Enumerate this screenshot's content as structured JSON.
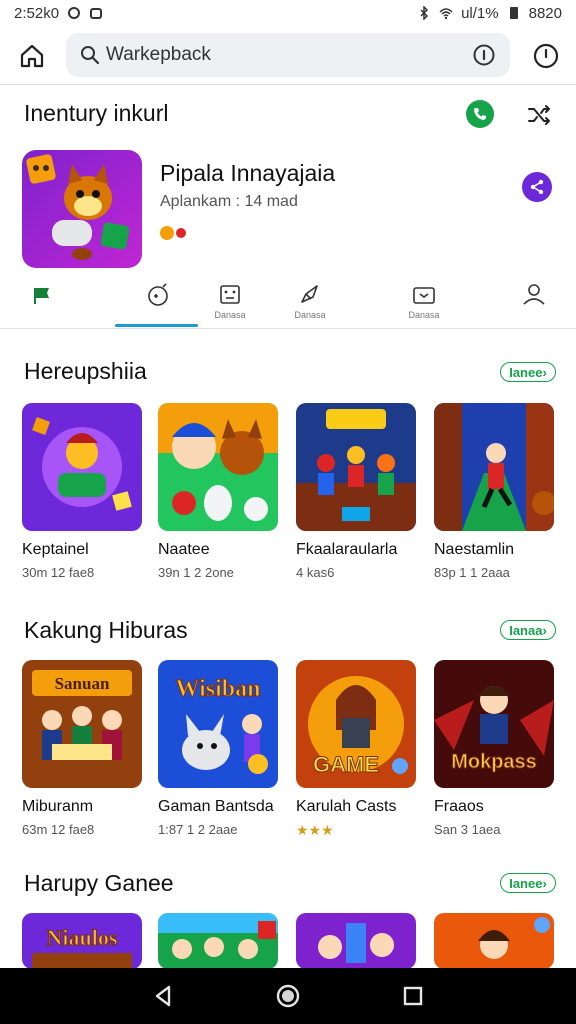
{
  "status_bar": {
    "time": "2:52k0",
    "right_text": "ul/1%",
    "battery": "8820"
  },
  "search": {
    "value": "Warkepback"
  },
  "header": {
    "title": "Inentury inkurl"
  },
  "featured_app": {
    "title": "Pipala Innayajaia",
    "subtitle": "Aplankam : 14 mad"
  },
  "tabs": [
    {
      "label": ""
    },
    {
      "label": ""
    },
    {
      "label": "Danasa"
    },
    {
      "label": "Danasa"
    },
    {
      "label": "Danasa"
    },
    {
      "label": ""
    }
  ],
  "sections": [
    {
      "title": "Hereupshiia",
      "more": "Ianee",
      "cards": [
        {
          "name": "Keptainel",
          "meta": "30m 12 fae8"
        },
        {
          "name": "Naatee",
          "meta": "39n 1 2 2one"
        },
        {
          "name": "Fkaalaraularla",
          "meta": "4 kas6"
        },
        {
          "name": "Naestamlin",
          "meta": "83p 1 1 2aaa"
        }
      ]
    },
    {
      "title": "Kakung Hiburas",
      "more": "Ianaa",
      "cards": [
        {
          "name": "Miburanm",
          "meta": "63m 12 fae8"
        },
        {
          "name": "Gaman Bantsda",
          "meta": "1:87 1 2 2aae"
        },
        {
          "name": "Karulah Casts",
          "meta": ""
        },
        {
          "name": "Fraaos",
          "meta": "San 3 1aea"
        }
      ],
      "thumb_text": [
        "Sanuan",
        "Wisiban",
        "GAME",
        "Mokpass"
      ]
    },
    {
      "title": "Harupy Ganee",
      "more": "Ianee",
      "thumb_text": [
        "Niaulos"
      ]
    }
  ],
  "colors": {
    "accent_green": "#16a34a",
    "tab_indicator": "#1a9ad1",
    "search_bg": "#eef1f3"
  }
}
